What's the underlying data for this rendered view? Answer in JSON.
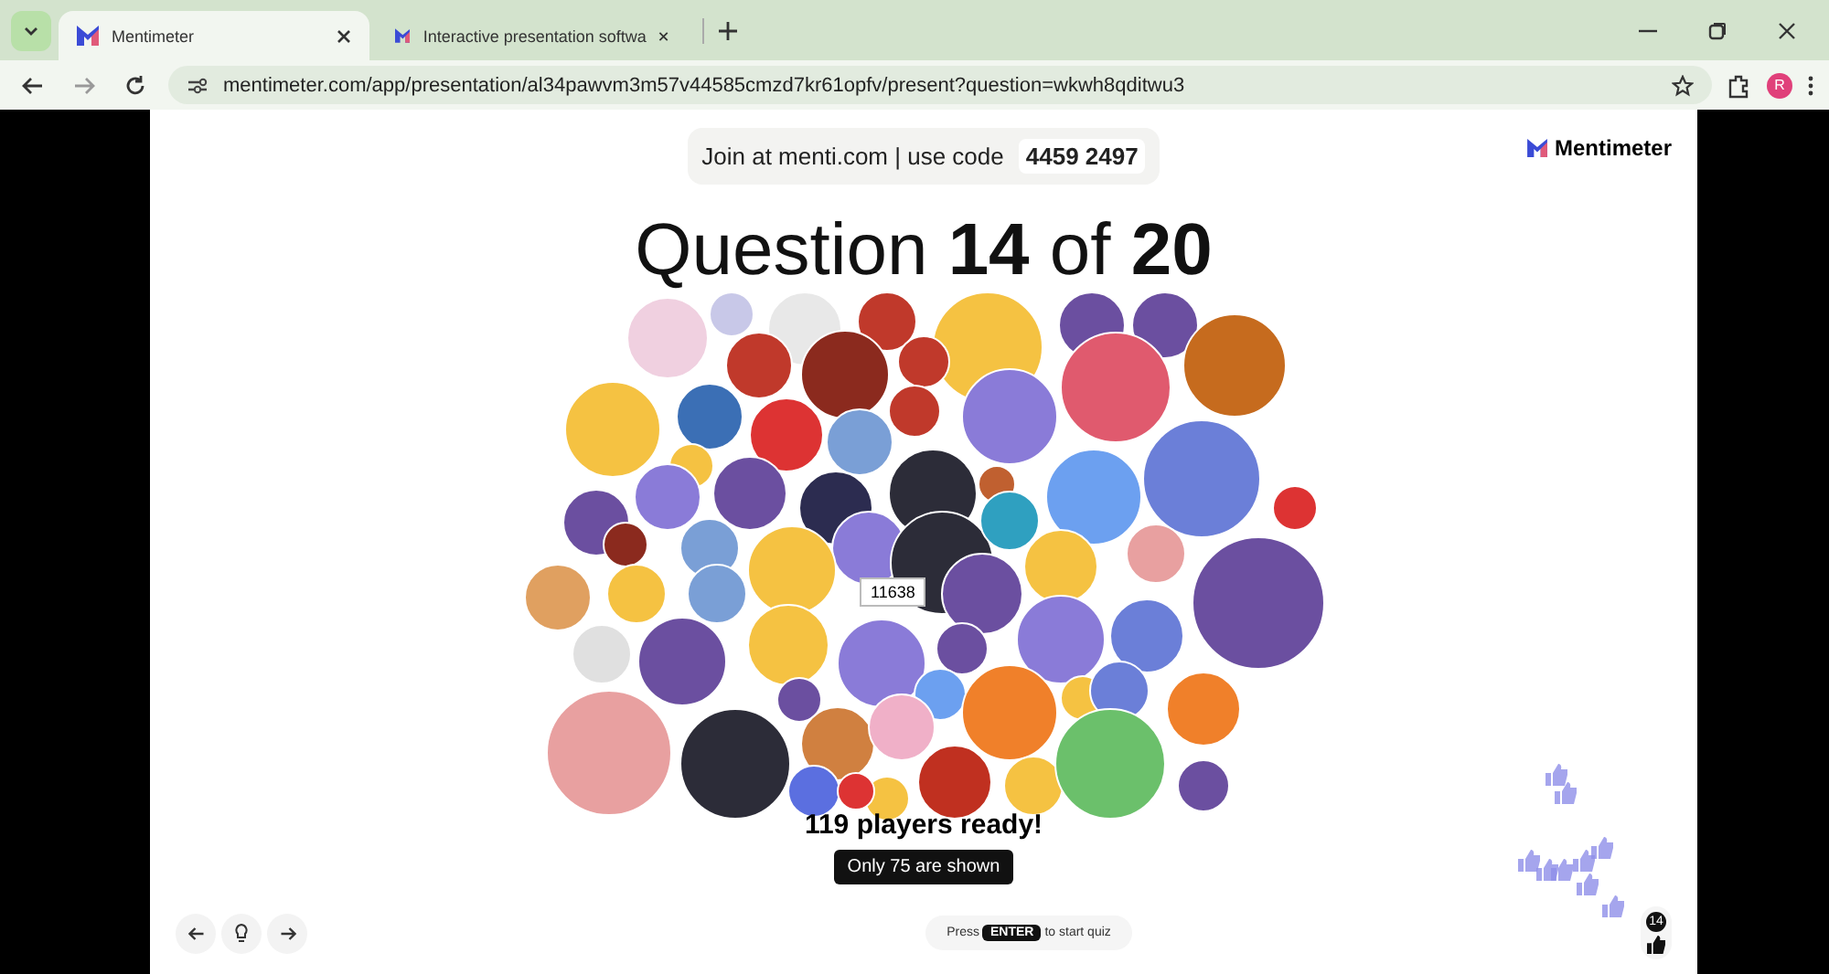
{
  "browser": {
    "tabs": [
      {
        "title": "Mentimeter",
        "selected": true
      },
      {
        "title": "Interactive presentation softwa",
        "selected": false
      }
    ],
    "url": "mentimeter.com/app/presentation/al34pawvm3m57v44585cmzd7kr61opfv/present?question=wkwh8qditwu3",
    "profile_initial": "R"
  },
  "slide": {
    "join_text": "Join at menti.com | use code",
    "code": "4459 2497",
    "logo": "Mentimeter",
    "title": "Question **14** of **20**",
    "tooltip": "11638",
    "players_ready": "119 players ready!",
    "shown_note": "Only 75 are shown",
    "hint": {
      "before": "Press",
      "key": "ENTER",
      "after": "to start quiz"
    },
    "reaction_count": "14"
  }
}
